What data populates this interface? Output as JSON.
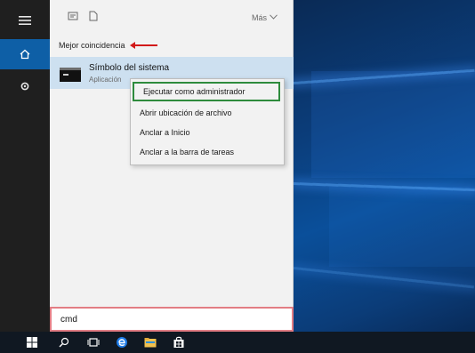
{
  "toolbar": {
    "documents_icon": "documents-icon",
    "file_icon": "file-icon",
    "more_label": "Más"
  },
  "best_match": {
    "label": "Mejor coincidencia"
  },
  "result": {
    "title": "Símbolo del sistema",
    "subtitle": "Aplicación"
  },
  "context_menu": {
    "items": [
      "Ejecutar como administrador",
      "Abrir ubicación de archivo",
      "Anclar a Inicio",
      "Anclar a la barra de tareas"
    ]
  },
  "search": {
    "value": "cmd"
  },
  "colors": {
    "accent": "#0e5fa6",
    "highlight_red": "#d21a1a",
    "highlight_green": "#2e8b3d"
  }
}
